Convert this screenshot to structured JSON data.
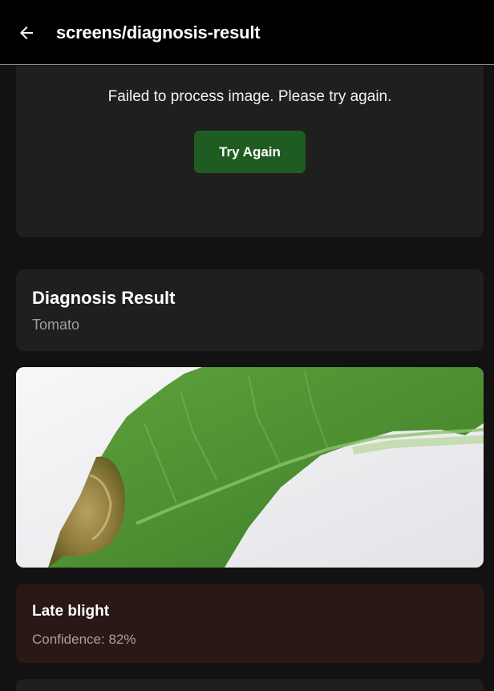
{
  "header": {
    "title": "screens/diagnosis-result",
    "back_icon": "arrow-left-icon"
  },
  "error": {
    "message": "Failed to process image. Please try again.",
    "retry_label": "Try Again"
  },
  "result": {
    "title": "Diagnosis Result",
    "crop": "Tomato"
  },
  "image": {
    "subject": "tomato-leaf-photo"
  },
  "disease": {
    "name": "Late blight",
    "confidence": "Confidence: 82%"
  },
  "colors": {
    "accent_green": "#1e5c22",
    "disease_card_bg": "#2a1816",
    "card_bg": "#1f1f1f",
    "page_bg": "#121212"
  }
}
